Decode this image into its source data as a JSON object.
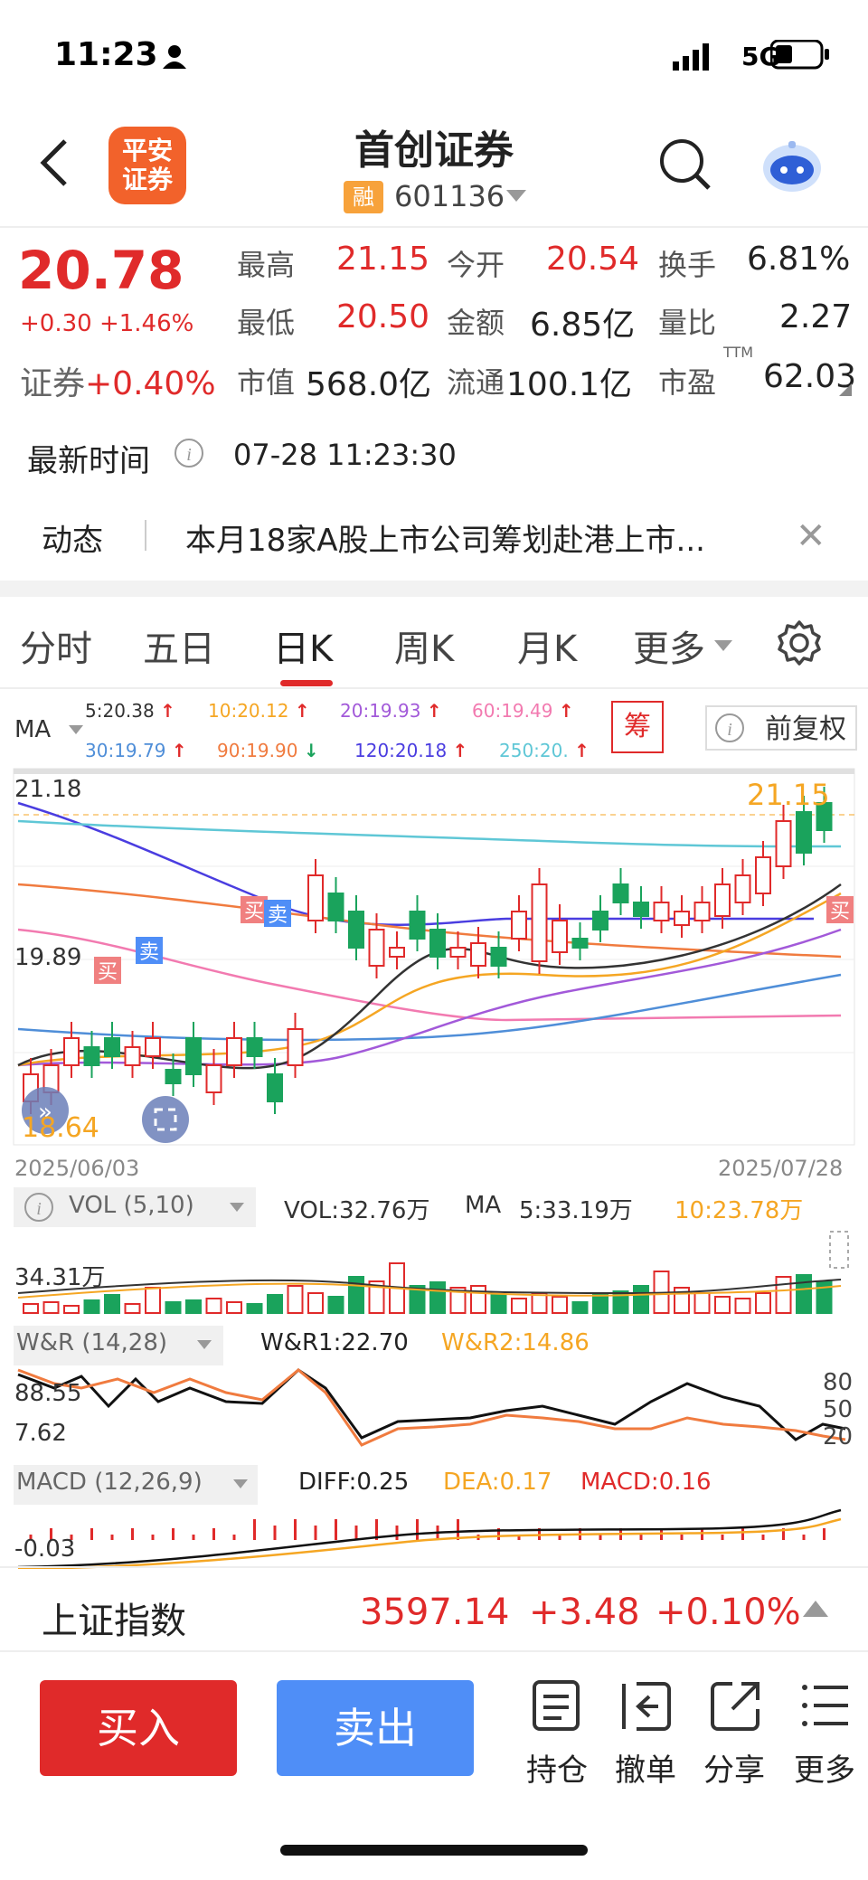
{
  "status_bar": {
    "time": "11:23",
    "network": "5G"
  },
  "header": {
    "logo_line1": "平安",
    "logo_line2": "证券",
    "title": "首创证券",
    "badge": "融",
    "code": "601136"
  },
  "quote": {
    "price": "20.78",
    "change": "+0.30 +1.46%",
    "sector_label": "证券",
    "sector_change": "+0.40%",
    "rows": [
      {
        "l1": "最高",
        "v1": "21.15",
        "l2": "今开",
        "v2": "20.54",
        "l3": "换手",
        "v3": "6.81%"
      },
      {
        "l1": "最低",
        "v1": "20.50",
        "l2": "金额",
        "v2": "6.85亿",
        "l3": "量比",
        "v3": "2.27"
      },
      {
        "l1": "市值",
        "v1": "568.0亿",
        "l2": "流通",
        "v2": "100.1亿",
        "l3": "市盈",
        "v3": "62.03",
        "ttm": "TTM"
      }
    ],
    "latest_label": "最新时间",
    "latest_time": "07-28 11:23:30"
  },
  "news": {
    "label": "动态",
    "text": "本月18家A股上市公司筹划赴港上市..."
  },
  "tabs": [
    "分时",
    "五日",
    "日K",
    "周K",
    "月K",
    "更多"
  ],
  "ma": {
    "label": "MA",
    "items": [
      {
        "text": "5:20.38",
        "color": "#333333",
        "dir": "↑"
      },
      {
        "text": "10:20.12",
        "color": "#f5a623",
        "dir": "↑"
      },
      {
        "text": "20:19.93",
        "color": "#a259d9",
        "dir": "↑"
      },
      {
        "text": "60:19.49",
        "color": "#f27ab0",
        "dir": "↑"
      },
      {
        "text": "30:19.79",
        "color": "#4f8ed8",
        "dir": "↑"
      },
      {
        "text": "90:19.90",
        "color": "#f07b3f",
        "dir": "↓"
      },
      {
        "text": "120:20.18",
        "color": "#4a3de0",
        "dir": "↑"
      },
      {
        "text": "250:20.",
        "color": "#5fc7d6",
        "dir": "↑"
      }
    ],
    "chou": "筹",
    "fuquan": "前复权"
  },
  "kline": {
    "high_label": "21.18",
    "high_mark": "21.15",
    "mid_label": "19.89",
    "low_label": "18.64",
    "start_date": "2025/06/03",
    "end_date": "2025/07/28",
    "buy_tag": "买",
    "sell_tag": "卖"
  },
  "vol": {
    "label": "VOL (5,10)",
    "vol": "VOL:32.76万",
    "ma": "MA",
    "ma5": "5:33.19万",
    "ma10": "10:23.78万",
    "axis": "34.31万"
  },
  "wr": {
    "label": "W&R (14,28)",
    "wr1": "W&R1:22.70",
    "wr2": "W&R2:14.86",
    "axis_hi": "88.55",
    "axis_lo": "7.62",
    "r80": "80",
    "r50": "50",
    "r20": "20"
  },
  "macd": {
    "label": "MACD (12,26,9)",
    "diff": "DIFF:0.25",
    "dea": "DEA:0.17",
    "macd": "MACD:0.16",
    "axis": "-0.03"
  },
  "index": {
    "name": "上证指数",
    "value": "3597.14",
    "change": "+3.48",
    "pct": "+0.10%"
  },
  "actions": {
    "buy": "买入",
    "sell": "卖出",
    "hold": "持仓",
    "cancel": "撤单",
    "share": "分享",
    "more": "更多"
  },
  "colors": {
    "up": "#e02a2a",
    "down": "#1aa35c",
    "accent": "#e02a2a",
    "sell_btn": "#4f8ef7"
  }
}
